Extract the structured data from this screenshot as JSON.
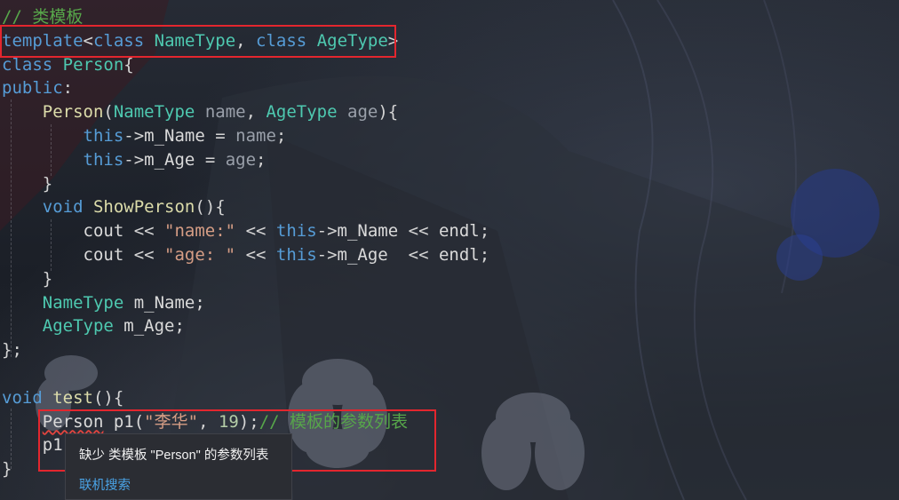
{
  "editor": {
    "lines": [
      [
        {
          "t": "// 类模板",
          "c": "cm"
        }
      ],
      [
        {
          "t": "template",
          "c": "kw"
        },
        {
          "t": "<",
          "c": "pu"
        },
        {
          "t": "class",
          "c": "kw"
        },
        {
          "t": " ",
          "c": "pu"
        },
        {
          "t": "NameType",
          "c": "tp"
        },
        {
          "t": ", ",
          "c": "pu"
        },
        {
          "t": "class",
          "c": "kw"
        },
        {
          "t": " ",
          "c": "pu"
        },
        {
          "t": "AgeType",
          "c": "tp"
        },
        {
          "t": ">",
          "c": "pu"
        }
      ],
      [
        {
          "t": "class",
          "c": "kw"
        },
        {
          "t": " ",
          "c": "pu"
        },
        {
          "t": "Person",
          "c": "tp"
        },
        {
          "t": "{",
          "c": "pu"
        }
      ],
      [
        {
          "t": "public",
          "c": "kw"
        },
        {
          "t": ":",
          "c": "pu"
        }
      ],
      [
        {
          "t": "    ",
          "c": "pu"
        },
        {
          "t": "Person",
          "c": "fn"
        },
        {
          "t": "(",
          "c": "pu"
        },
        {
          "t": "NameType",
          "c": "tp"
        },
        {
          "t": " ",
          "c": "pu"
        },
        {
          "t": "name",
          "c": "pm"
        },
        {
          "t": ", ",
          "c": "pu"
        },
        {
          "t": "AgeType",
          "c": "tp"
        },
        {
          "t": " ",
          "c": "pu"
        },
        {
          "t": "age",
          "c": "pm"
        },
        {
          "t": "){",
          "c": "pu"
        }
      ],
      [
        {
          "t": "        ",
          "c": "pu"
        },
        {
          "t": "this",
          "c": "kw"
        },
        {
          "t": "->",
          "c": "pu"
        },
        {
          "t": "m_Name",
          "c": "vr"
        },
        {
          "t": " = ",
          "c": "pu"
        },
        {
          "t": "name",
          "c": "pm"
        },
        {
          "t": ";",
          "c": "pu"
        }
      ],
      [
        {
          "t": "        ",
          "c": "pu"
        },
        {
          "t": "this",
          "c": "kw"
        },
        {
          "t": "->",
          "c": "pu"
        },
        {
          "t": "m_Age",
          "c": "vr"
        },
        {
          "t": " = ",
          "c": "pu"
        },
        {
          "t": "age",
          "c": "pm"
        },
        {
          "t": ";",
          "c": "pu"
        }
      ],
      [
        {
          "t": "    }",
          "c": "pu"
        }
      ],
      [
        {
          "t": "    ",
          "c": "pu"
        },
        {
          "t": "void",
          "c": "kw"
        },
        {
          "t": " ",
          "c": "pu"
        },
        {
          "t": "ShowPerson",
          "c": "fn"
        },
        {
          "t": "(){",
          "c": "pu"
        }
      ],
      [
        {
          "t": "        ",
          "c": "pu"
        },
        {
          "t": "cout",
          "c": "vr"
        },
        {
          "t": " << ",
          "c": "pu"
        },
        {
          "t": "\"name:\"",
          "c": "st"
        },
        {
          "t": " << ",
          "c": "pu"
        },
        {
          "t": "this",
          "c": "kw"
        },
        {
          "t": "->",
          "c": "pu"
        },
        {
          "t": "m_Name",
          "c": "vr"
        },
        {
          "t": " << ",
          "c": "pu"
        },
        {
          "t": "endl",
          "c": "vr"
        },
        {
          "t": ";",
          "c": "pu"
        }
      ],
      [
        {
          "t": "        ",
          "c": "pu"
        },
        {
          "t": "cout",
          "c": "vr"
        },
        {
          "t": " << ",
          "c": "pu"
        },
        {
          "t": "\"age: \"",
          "c": "st"
        },
        {
          "t": " << ",
          "c": "pu"
        },
        {
          "t": "this",
          "c": "kw"
        },
        {
          "t": "->",
          "c": "pu"
        },
        {
          "t": "m_Age",
          "c": "vr"
        },
        {
          "t": "  << ",
          "c": "pu"
        },
        {
          "t": "endl",
          "c": "vr"
        },
        {
          "t": ";",
          "c": "pu"
        }
      ],
      [
        {
          "t": "    }",
          "c": "pu"
        }
      ],
      [
        {
          "t": "    ",
          "c": "pu"
        },
        {
          "t": "NameType",
          "c": "tp"
        },
        {
          "t": " m_Name;",
          "c": "vr"
        }
      ],
      [
        {
          "t": "    ",
          "c": "pu"
        },
        {
          "t": "AgeType",
          "c": "tp"
        },
        {
          "t": " m_Age;",
          "c": "vr"
        }
      ],
      [
        {
          "t": "};",
          "c": "pu"
        }
      ],
      [],
      [
        {
          "t": "void",
          "c": "kw"
        },
        {
          "t": " ",
          "c": "pu"
        },
        {
          "t": "test",
          "c": "fn"
        },
        {
          "t": "(){",
          "c": "pu"
        }
      ],
      [
        {
          "t": "    ",
          "c": "pu"
        },
        {
          "t": "Person",
          "c": "vr squiggle"
        },
        {
          "t": " p1(",
          "c": "vr"
        },
        {
          "t": "\"李华\"",
          "c": "st"
        },
        {
          "t": ", ",
          "c": "pu"
        },
        {
          "t": "19",
          "c": "nm"
        },
        {
          "t": ");",
          "c": "pu"
        },
        {
          "t": "// 模板的参数列表",
          "c": "cm"
        }
      ],
      [
        {
          "t": "    ",
          "c": "pu"
        },
        {
          "t": "p1.",
          "c": "vr"
        }
      ],
      [
        {
          "t": "}",
          "c": "pu"
        }
      ]
    ]
  },
  "tooltip": {
    "message": "缺少 类模板 \"Person\" 的参数列表",
    "link": "联机搜索"
  },
  "colors": {
    "keyword": "#569cd6",
    "type": "#4ec9b0",
    "function": "#dcdcaa",
    "comment": "#57a64a",
    "string": "#d69d85",
    "number": "#b5cea8",
    "highlight_box": "#e3262e",
    "tooltip_link": "#4aa3e6"
  }
}
